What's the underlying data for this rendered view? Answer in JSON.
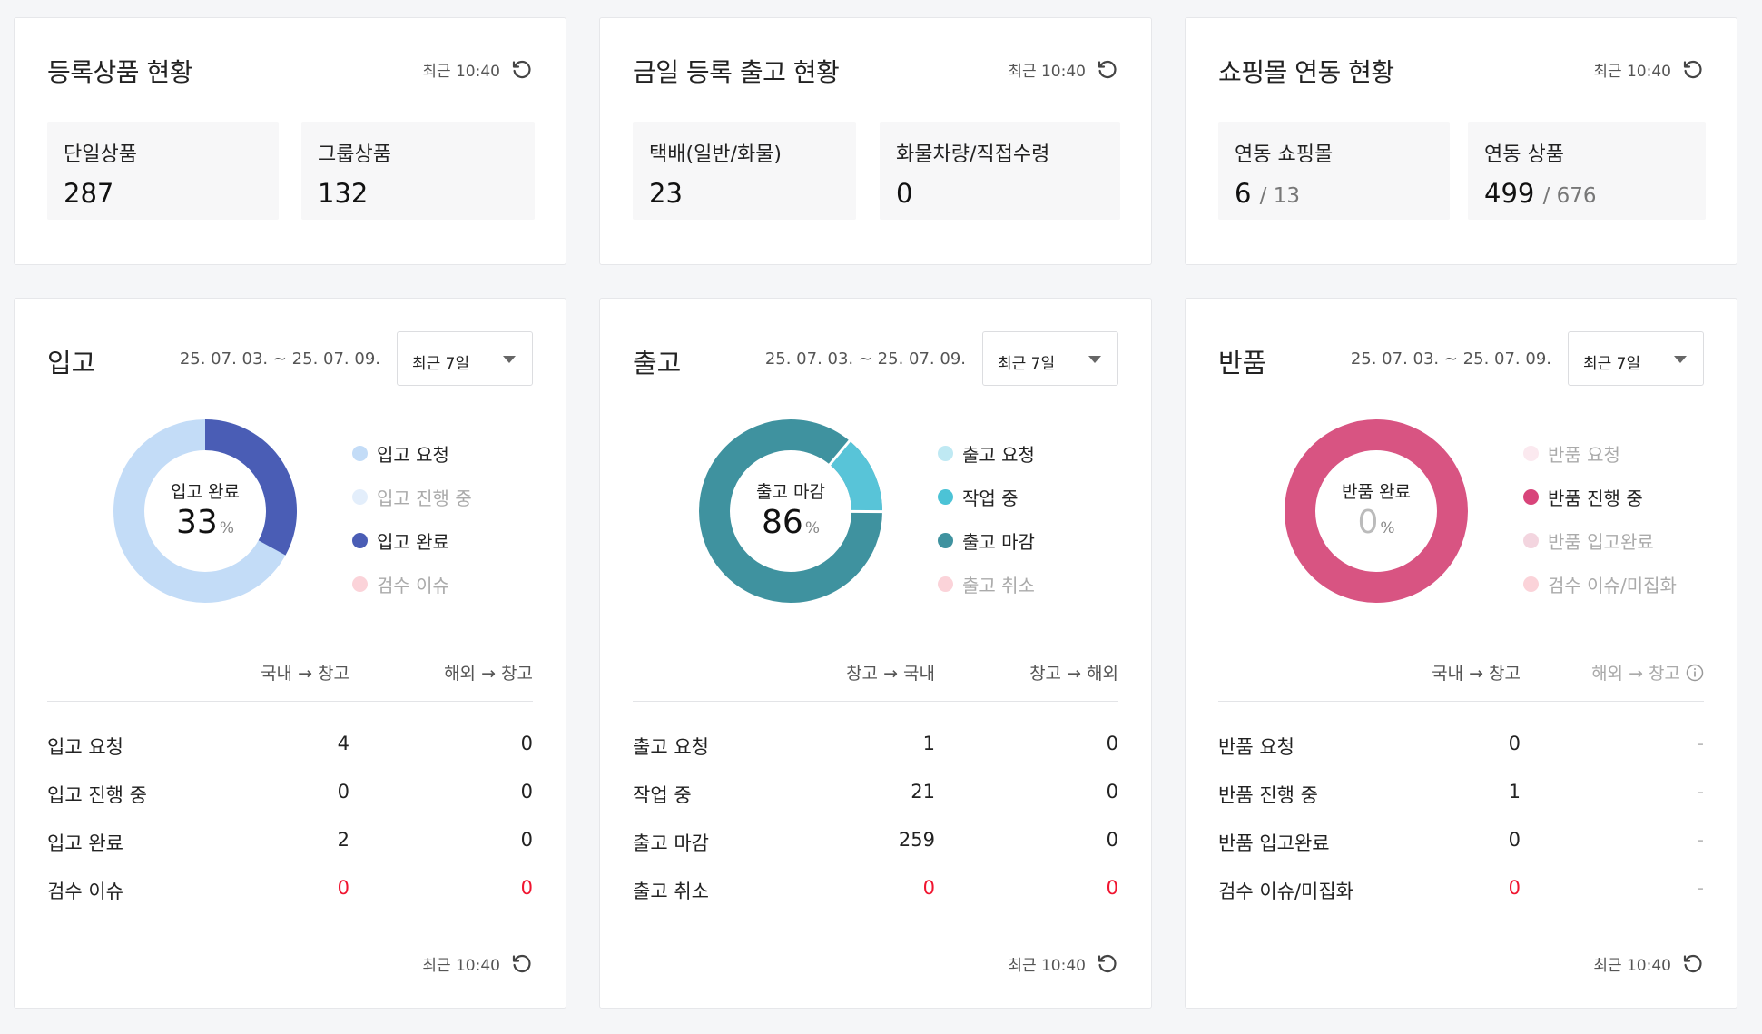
{
  "summary": [
    {
      "title": "등록상품 현황",
      "refresh": "최근 10:40",
      "stats": [
        {
          "label": "단일상품",
          "value": "287",
          "total": ""
        },
        {
          "label": "그룹상품",
          "value": "132",
          "total": ""
        }
      ]
    },
    {
      "title": "금일 등록 출고 현황",
      "refresh": "최근 10:40",
      "stats": [
        {
          "label": "택배(일반/화물)",
          "value": "23",
          "total": ""
        },
        {
          "label": "화물차량/직접수령",
          "value": "0",
          "total": ""
        }
      ]
    },
    {
      "title": "쇼핑몰 연동 현황",
      "refresh": "최근 10:40",
      "stats": [
        {
          "label": "연동 쇼핑몰",
          "value": "6",
          "total": "/ 13"
        },
        {
          "label": "연동 상품",
          "value": "499",
          "total": "/ 676"
        }
      ]
    }
  ],
  "panels": [
    {
      "title": "입고",
      "date_range": "25. 07. 03. ~ 25. 07. 09.",
      "period": "최근 7일",
      "donut": {
        "label": "입고 완료",
        "value": "33",
        "unit": "%",
        "ring_color": "#c3dcf7",
        "segments": [
          {
            "fraction": 0.33,
            "color": "#4a5db5"
          }
        ]
      },
      "legend": [
        {
          "label": "입고 요청",
          "color": "#c3dcf7",
          "muted": false
        },
        {
          "label": "입고 진행 중",
          "color": "#e3eefb",
          "muted": true
        },
        {
          "label": "입고 완료",
          "color": "#4a5db5",
          "muted": false
        },
        {
          "label": "검수 이슈",
          "color": "#fbd3d9",
          "muted": true
        }
      ],
      "col_a": "국내 → 창고",
      "col_b": "해외 → 창고",
      "col_b_info": false,
      "rows": [
        {
          "label": "입고 요청",
          "a": "4",
          "b": "0",
          "red": false
        },
        {
          "label": "입고 진행 중",
          "a": "0",
          "b": "0",
          "red": false
        },
        {
          "label": "입고 완료",
          "a": "2",
          "b": "0",
          "red": false
        },
        {
          "label": "검수 이슈",
          "a": "0",
          "b": "0",
          "red": true
        }
      ],
      "footer": "최근 10:40"
    },
    {
      "title": "출고",
      "date_range": "25. 07. 03. ~ 25. 07. 09.",
      "period": "최근 7일",
      "donut": {
        "label": "출고 마감",
        "value": "86",
        "unit": "%",
        "ring_color": "#3f929f",
        "segments": [
          {
            "fraction": 0.14,
            "color": "#58c4d8",
            "start": 0.111
          }
        ]
      },
      "legend": [
        {
          "label": "출고 요청",
          "color": "#bfe9f3",
          "muted": false
        },
        {
          "label": "작업 중",
          "color": "#4cc3d6",
          "muted": false
        },
        {
          "label": "출고 마감",
          "color": "#3f929f",
          "muted": false
        },
        {
          "label": "출고 취소",
          "color": "#fbd3d9",
          "muted": true
        }
      ],
      "col_a": "창고 → 국내",
      "col_b": "창고 → 해외",
      "col_b_info": false,
      "rows": [
        {
          "label": "출고 요청",
          "a": "1",
          "b": "0",
          "red": false
        },
        {
          "label": "작업 중",
          "a": "21",
          "b": "0",
          "red": false
        },
        {
          "label": "출고 마감",
          "a": "259",
          "b": "0",
          "red": false
        },
        {
          "label": "출고 취소",
          "a": "0",
          "b": "0",
          "red": true
        }
      ],
      "footer": "최근 10:40"
    },
    {
      "title": "반품",
      "date_range": "25. 07. 03. ~ 25. 07. 09.",
      "period": "최근 7일",
      "donut": {
        "label": "반품 완료",
        "value": "0",
        "unit": "%",
        "ring_color": "#d85482",
        "segments": []
      },
      "legend": [
        {
          "label": "반품 요청",
          "color": "#fbe9ef",
          "muted": true
        },
        {
          "label": "반품 진행 중",
          "color": "#d8447a",
          "muted": false
        },
        {
          "label": "반품 입고완료",
          "color": "#f3d5df",
          "muted": true
        },
        {
          "label": "검수 이슈/미집화",
          "color": "#fbd3d9",
          "muted": true
        }
      ],
      "col_a": "국내 → 창고",
      "col_b": "해외 → 창고",
      "col_b_info": true,
      "rows": [
        {
          "label": "반품 요청",
          "a": "0",
          "b": "-",
          "red": false
        },
        {
          "label": "반품 진행 중",
          "a": "1",
          "b": "-",
          "red": false
        },
        {
          "label": "반품 입고완료",
          "a": "0",
          "b": "-",
          "red": false
        },
        {
          "label": "검수 이슈/미집화",
          "a": "0",
          "b": "-",
          "red": true
        }
      ],
      "footer": "최근 10:40"
    }
  ]
}
